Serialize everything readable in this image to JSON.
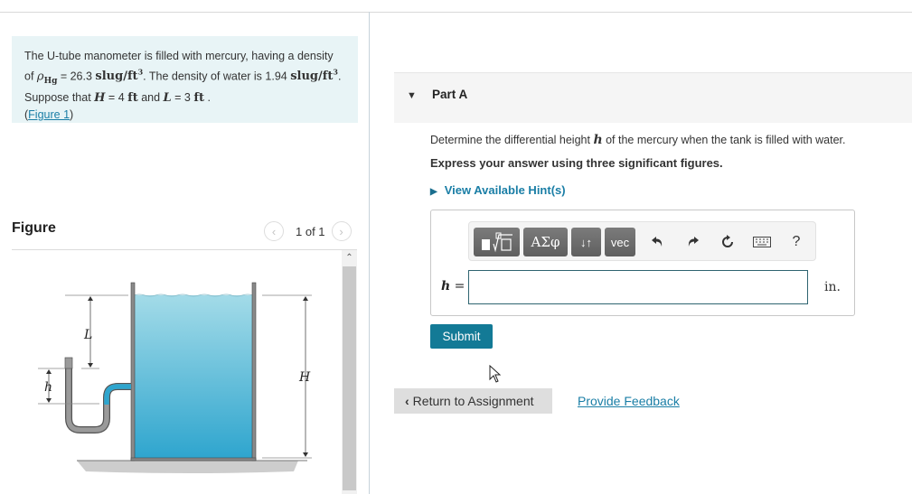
{
  "problem": {
    "text_1": "The U-tube manometer is filled with mercury, having a density of ",
    "rho_symbol": "ρ",
    "rho_sub": "Hg",
    "text_2": " = 26.3 ",
    "unit_slug": "slug/ft",
    "unit_exp": "3",
    "text_3": ". The density of water is 1.94 ",
    "text_4": ". Suppose that ",
    "var_H": "H",
    "text_5": " = 4 ",
    "unit_ft": "ft",
    "text_6": " and ",
    "var_L": "L",
    "text_7": " = 3 ",
    "text_8": " .",
    "figure_link_open": "(",
    "figure_link": "Figure 1",
    "figure_link_close": ")"
  },
  "figure": {
    "title": "Figure",
    "pager": "1 of 1",
    "prev_icon": "‹",
    "next_icon": "›",
    "scroll_up_icon": "⌃",
    "labels": {
      "L": "L",
      "H": "H",
      "h": "h"
    },
    "colors": {
      "water_top": "#9fd8e6",
      "water_bottom": "#2fa6cf",
      "tube": "#8c8c8c",
      "ground": "#c8c8c8"
    }
  },
  "part": {
    "caret_icon": "▼",
    "title": "Part A",
    "question_1": "Determine the differential height ",
    "question_var": "h",
    "question_2": " of the mercury when the tank is filled with water.",
    "instruction": "Express your answer using three significant figures.",
    "hints_icon": "▶",
    "hints_label": "View Available Hint(s)"
  },
  "toolbar": {
    "templates_label": "templates",
    "greek_label": "ΑΣφ",
    "arrows_label": "↓↑",
    "vec_label": "vec",
    "undo_icon": "undo",
    "redo_icon": "redo",
    "reset_icon": "reset",
    "keyboard_icon": "keyboard",
    "help_label": "?"
  },
  "answer": {
    "var": "h",
    "equals": " =",
    "value": "",
    "placeholder": "",
    "unit": "in."
  },
  "actions": {
    "submit": "Submit",
    "return_chevron": "‹",
    "return_label": "Return to Assignment",
    "feedback": "Provide Feedback"
  },
  "colors": {
    "accent": "#137a96",
    "link": "#1a7ea6",
    "problem_bg": "#e8f4f6"
  }
}
